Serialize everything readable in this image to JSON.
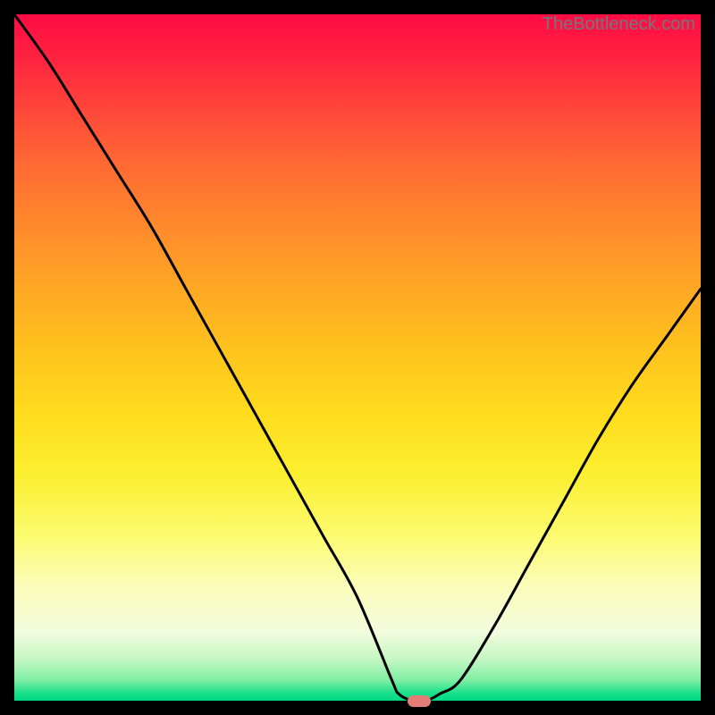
{
  "watermark": {
    "text": "TheBottleneck.com"
  },
  "colors": {
    "frame": "#000000",
    "curve": "#000000",
    "marker": "#e37c77",
    "gradient_top": "#ff0b44",
    "gradient_bottom": "#00d884"
  },
  "chart_data": {
    "type": "line",
    "title": "",
    "xlabel": "",
    "ylabel": "",
    "xlim": [
      0,
      100
    ],
    "ylim": [
      0,
      100
    ],
    "series": [
      {
        "name": "bottleneck-curve",
        "x": [
          0,
          5,
          10,
          15,
          20,
          25,
          30,
          35,
          40,
          45,
          50,
          55,
          56,
          58,
          60,
          62,
          65,
          70,
          75,
          80,
          85,
          90,
          95,
          100
        ],
        "y": [
          100,
          93,
          85,
          77,
          69,
          60,
          51,
          42,
          33,
          24,
          15,
          3,
          1,
          0,
          0,
          1,
          3,
          11,
          20,
          29,
          38,
          46,
          53,
          60
        ]
      }
    ],
    "marker": {
      "x": 59,
      "y": 0,
      "label": "optimal-point"
    },
    "grid": false,
    "legend": false
  }
}
